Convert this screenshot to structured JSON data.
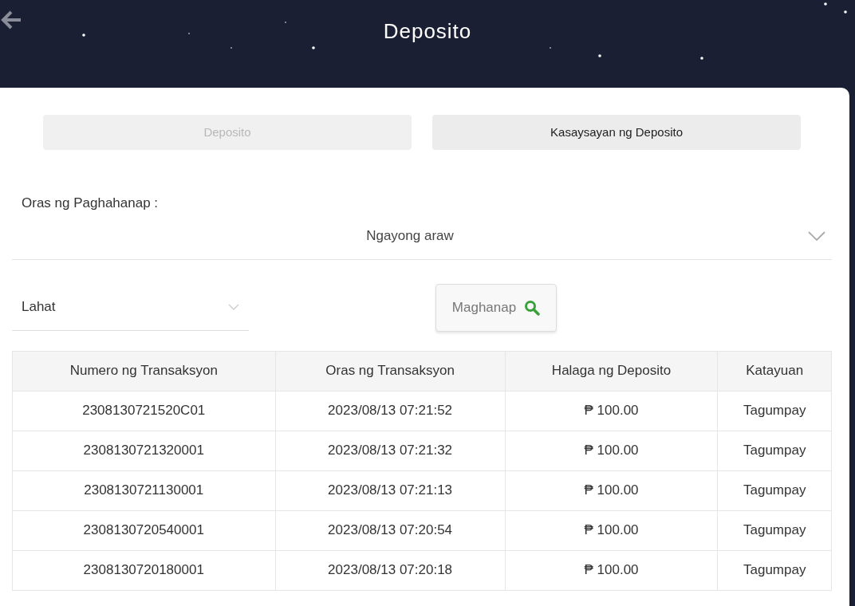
{
  "header": {
    "title": "Deposito"
  },
  "tabs": [
    {
      "label": "Deposito",
      "selected": false
    },
    {
      "label": "Kasaysayan ng Deposito",
      "selected": true
    }
  ],
  "search_time": {
    "label": "Oras ng Paghahanap :",
    "value": "Ngayong araw"
  },
  "status_filter": {
    "value": "Lahat"
  },
  "search_button": {
    "label": "Maghanap"
  },
  "table": {
    "columns": [
      "Numero ng Transaksyon",
      "Oras ng Transaksyon",
      "Halaga ng Deposito",
      "Katayuan"
    ],
    "rows": [
      [
        "2308130721520C01",
        "2023/08/13 07:21:52",
        "₱ 100.00",
        "Tagumpay"
      ],
      [
        "2308130721320001",
        "2023/08/13 07:21:32",
        "₱ 100.00",
        "Tagumpay"
      ],
      [
        "2308130721130001",
        "2023/08/13 07:21:13",
        "₱ 100.00",
        "Tagumpay"
      ],
      [
        "2308130720540001",
        "2023/08/13 07:20:54",
        "₱ 100.00",
        "Tagumpay"
      ],
      [
        "2308130720180001",
        "2023/08/13 07:20:18",
        "₱ 100.00",
        "Tagumpay"
      ]
    ]
  }
}
